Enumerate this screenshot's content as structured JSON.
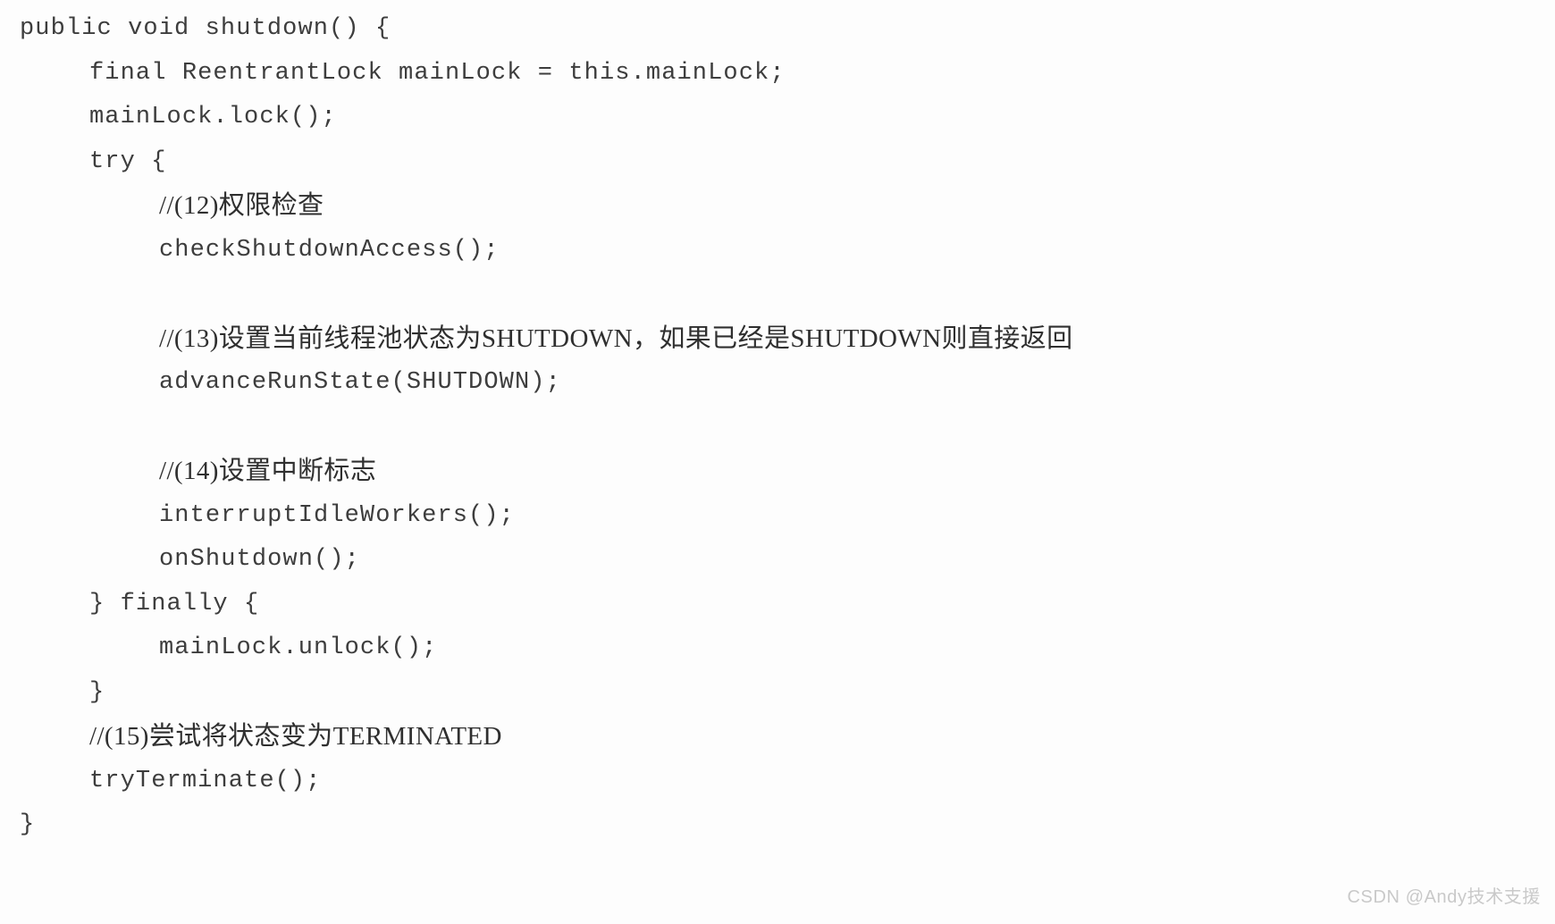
{
  "page": {
    "type": "scanned-code-figure",
    "background_color": "#fdfdfd",
    "text_color": "#3d3d3d",
    "language": "java",
    "method_name": "shutdown"
  },
  "code": {
    "lines": [
      {
        "id": "line-01",
        "indent": 0,
        "kind": "code",
        "text": "public void shutdown() {"
      },
      {
        "id": "line-02",
        "indent": 1,
        "kind": "code",
        "text": "final ReentrantLock mainLock = this.mainLock;"
      },
      {
        "id": "line-03",
        "indent": 1,
        "kind": "code",
        "text": "mainLock.lock();"
      },
      {
        "id": "line-04",
        "indent": 1,
        "kind": "code",
        "text": "try {"
      },
      {
        "id": "line-05",
        "indent": 2,
        "kind": "comment",
        "text": "//(12)权限检查"
      },
      {
        "id": "line-06",
        "indent": 2,
        "kind": "code",
        "text": "checkShutdownAccess();"
      },
      {
        "id": "line-07",
        "indent": 0,
        "kind": "blank",
        "text": ""
      },
      {
        "id": "line-08",
        "indent": 2,
        "kind": "comment",
        "text": "//(13)设置当前线程池状态为SHUTDOWN，如果已经是SHUTDOWN则直接返回"
      },
      {
        "id": "line-09",
        "indent": 2,
        "kind": "code",
        "text": "advanceRunState(SHUTDOWN);"
      },
      {
        "id": "line-10",
        "indent": 0,
        "kind": "blank",
        "text": ""
      },
      {
        "id": "line-11",
        "indent": 2,
        "kind": "comment",
        "text": "//(14)设置中断标志"
      },
      {
        "id": "line-12",
        "indent": 2,
        "kind": "code",
        "text": "interruptIdleWorkers();"
      },
      {
        "id": "line-13",
        "indent": 2,
        "kind": "code",
        "text": "onShutdown();"
      },
      {
        "id": "line-14",
        "indent": 1,
        "kind": "code",
        "text": "} finally {"
      },
      {
        "id": "line-15",
        "indent": 2,
        "kind": "code",
        "text": "mainLock.unlock();"
      },
      {
        "id": "line-16",
        "indent": 1,
        "kind": "code",
        "text": "}"
      },
      {
        "id": "line-17",
        "indent": 1,
        "kind": "comment",
        "text": "//(15)尝试将状态变为TERMINATED"
      },
      {
        "id": "line-18",
        "indent": 1,
        "kind": "code",
        "text": "tryTerminate();"
      },
      {
        "id": "line-19",
        "indent": 0,
        "kind": "code",
        "text": "}"
      }
    ]
  },
  "watermark": {
    "text": "CSDN @Andy技术支援",
    "color": "#c9c9c9"
  }
}
